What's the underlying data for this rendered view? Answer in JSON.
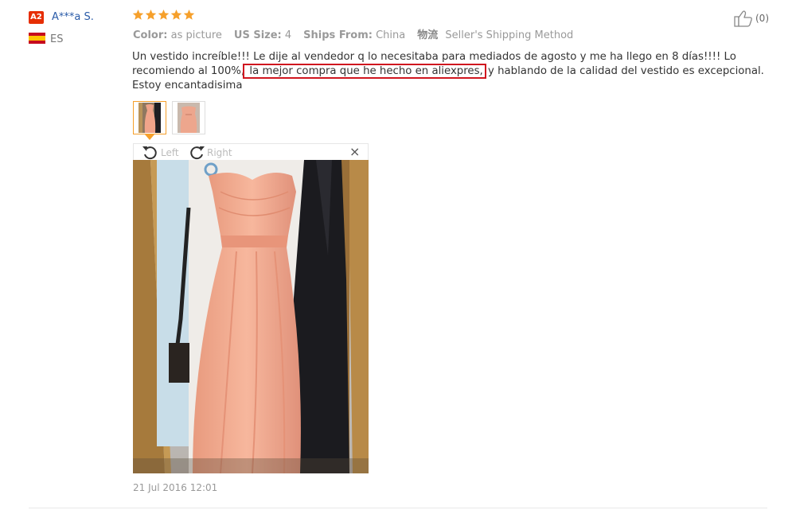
{
  "user": {
    "level_badge": "A2",
    "name": "A***a S.",
    "country": "ES"
  },
  "rating": {
    "stars": 5,
    "star_color": "#f6a02b"
  },
  "attributes": {
    "color_key": "Color:",
    "color_val": "as picture",
    "size_key": "US Size:",
    "size_val": "4",
    "ships_key": "Ships From:",
    "ships_val": "China",
    "logistics_key": "物流",
    "logistics_val": "Seller's Shipping Method"
  },
  "like": {
    "count": "(0)"
  },
  "review": {
    "text_before": "Un vestido increíble!!! Le dije al vendedor q lo necesitaba para mediados de agosto y me ha llego en 8 días!!!! Lo recomiendo al 100%,",
    "text_highlight": " la mejor compra que he hecho en aliexpres,",
    "text_after": " y hablando de la calidad del vestido es excepcional. Estoy encantadisima",
    "highlight_color": "#d0161f"
  },
  "viewer": {
    "rotate_left_label": "Left",
    "rotate_right_label": "Right",
    "close_label": "×"
  },
  "date": "21 Jul 2016 12:01"
}
